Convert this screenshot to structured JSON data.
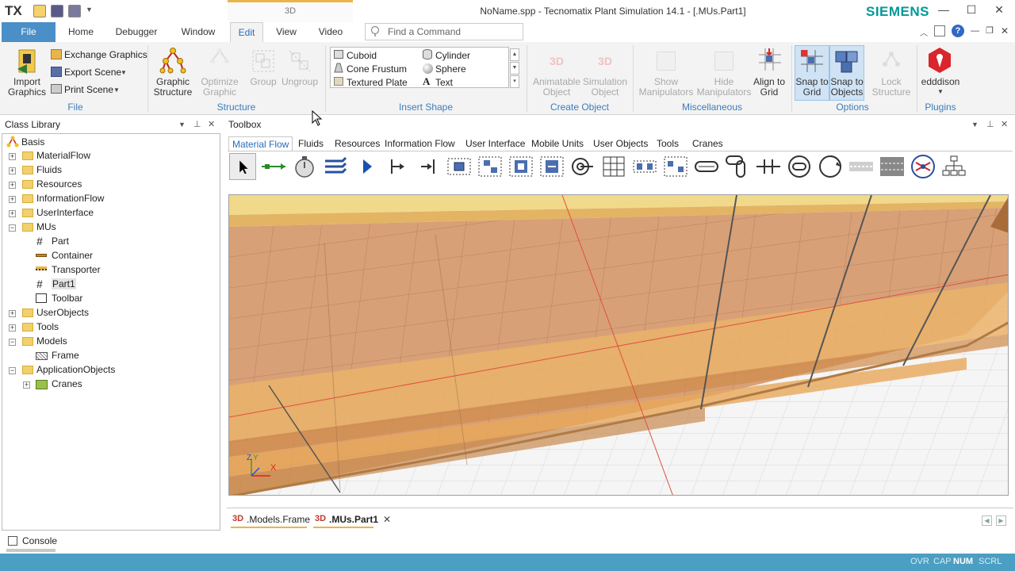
{
  "titlebar": {
    "logo": "TX",
    "context_tab": "3D",
    "window_title": "NoName.spp - Tecnomatix Plant Simulation 14.1 - [.MUs.Part1]",
    "brand": "SIEMENS",
    "minimize": "—",
    "maximize": "☐",
    "close": "✕"
  },
  "tabs": [
    "File",
    "Home",
    "Debugger",
    "Window",
    "Edit",
    "View",
    "Video"
  ],
  "find_command_placeholder": "Find a Command",
  "ribbon": {
    "file_group": {
      "import_graphics": "Import Graphics",
      "exchange_graphics": "Exchange Graphics",
      "export_scene": "Export Scene",
      "print_scene": "Print Scene",
      "label": "File"
    },
    "structure_group": {
      "graphic_structure": "Graphic Structure",
      "optimize_graphic": "Optimize Graphic",
      "group": "Group",
      "ungroup": "Ungroup",
      "label": "Structure"
    },
    "insert_shape_group": {
      "cuboid": "Cuboid",
      "cylinder": "Cylinder",
      "cone_frustum": "Cone Frustum",
      "sphere": "Sphere",
      "textured_plate": "Textured Plate",
      "text": "Text",
      "label": "Insert Shape"
    },
    "create_object_group": {
      "animatable_object": "Animatable Object",
      "simulation_object": "Simulation Object",
      "label": "Create Object"
    },
    "misc_group": {
      "show_manipulators": "Show Manipulators",
      "hide_manipulators": "Hide Manipulators",
      "align_to_grid": "Align to Grid",
      "label": "Miscellaneous"
    },
    "options_group": {
      "snap_to_grid": "Snap to Grid",
      "snap_to_objects": "Snap to Objects",
      "lock_structure": "Lock Structure",
      "label": "Options"
    },
    "plugins_group": {
      "edddison": "edddison",
      "label": "Plugins"
    }
  },
  "class_library": {
    "title": "Class Library",
    "items": [
      {
        "label": "Basis",
        "depth": 0
      },
      {
        "label": "MaterialFlow",
        "depth": 1
      },
      {
        "label": "Fluids",
        "depth": 1
      },
      {
        "label": "Resources",
        "depth": 1
      },
      {
        "label": "InformationFlow",
        "depth": 1
      },
      {
        "label": "UserInterface",
        "depth": 1
      },
      {
        "label": "MUs",
        "depth": 1
      },
      {
        "label": "Part",
        "depth": 2
      },
      {
        "label": "Container",
        "depth": 2
      },
      {
        "label": "Transporter",
        "depth": 2
      },
      {
        "label": "Part1",
        "depth": 2
      },
      {
        "label": "Toolbar",
        "depth": 2
      },
      {
        "label": "UserObjects",
        "depth": 1
      },
      {
        "label": "Tools",
        "depth": 1
      },
      {
        "label": "Models",
        "depth": 1
      },
      {
        "label": "Frame",
        "depth": 2
      },
      {
        "label": "ApplicationObjects",
        "depth": 1
      },
      {
        "label": "Cranes",
        "depth": 2
      }
    ]
  },
  "toolbox": {
    "title": "Toolbox",
    "tabs": [
      "Material Flow",
      "Fluids",
      "Resources",
      "Information Flow",
      "User Interface",
      "Mobile Units",
      "User Objects",
      "Tools",
      "Cranes"
    ]
  },
  "doc_tabs": [
    {
      "label": ".Models.Frame",
      "tag": "3D"
    },
    {
      "label": ".MUs.Part1",
      "tag": "3D"
    }
  ],
  "console": "Console",
  "status": [
    "OVR",
    "CAP",
    "NUM",
    "SCRL"
  ],
  "axis_labels": {
    "z": "Z",
    "y": "Y",
    "x": "X"
  },
  "colors": {
    "accent": "#2a6dbb",
    "file_tab": "#4a8fc7",
    "statusbar": "#4b9fc2",
    "brand": "#009999",
    "context_tab": "#e8b54a"
  }
}
